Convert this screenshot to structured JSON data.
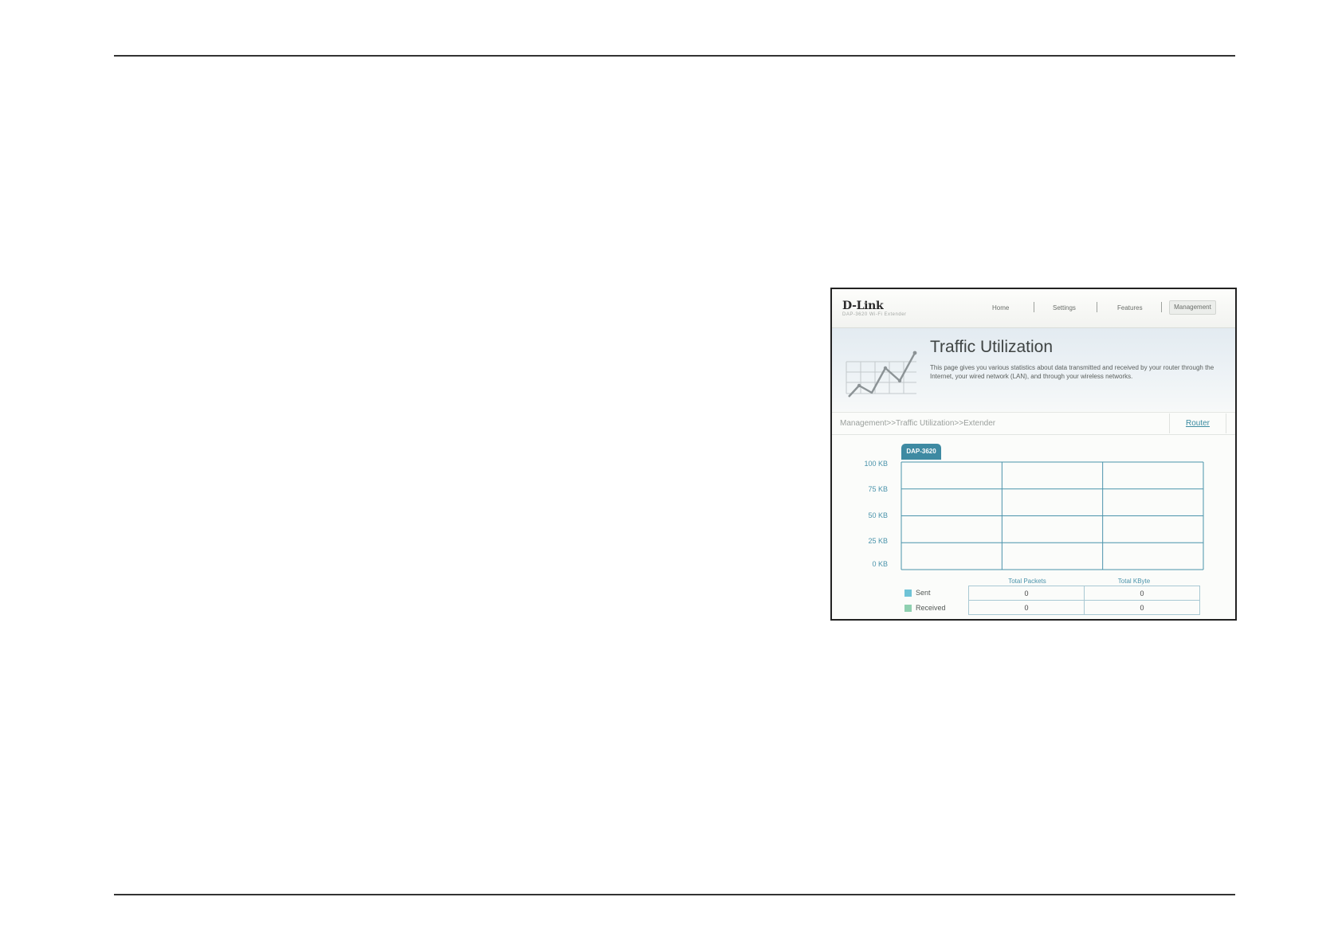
{
  "screenshot": {
    "header": {
      "logo": "D-Link",
      "logo_subtitle": "DAP-3620 Wi-Fi Extender",
      "nav": {
        "home": "Home",
        "settings": "Settings",
        "features": "Features",
        "management": "Management"
      },
      "active_nav": "Management"
    },
    "banner": {
      "title": "Traffic Utilization",
      "description": "This page gives you various statistics about data transmitted and received by your router through the Internet, your wired network (LAN), and through your wireless networks."
    },
    "breadcrumb": "Management>>Traffic Utilization>>Extender",
    "router_link": "Router",
    "chart": {
      "tab_label": "DAP-3620",
      "y_ticks": [
        "100 KB",
        "75 KB",
        "50 KB",
        "25 KB",
        "0 KB"
      ]
    },
    "stats": {
      "headers": [
        "Total Packets",
        "Total KByte"
      ],
      "rows": [
        {
          "label": "Sent",
          "color": "#6fc3d6",
          "total_packets": "0",
          "total_kbyte": "0"
        },
        {
          "label": "Received",
          "color": "#8fd0b0",
          "total_packets": "0",
          "total_kbyte": "0"
        }
      ]
    },
    "colors": {
      "accent": "#3e8aa2",
      "grid_line": "#4a93ab"
    }
  },
  "chart_data": {
    "type": "line",
    "categories": [],
    "series": [],
    "ylabel": "",
    "ylim": [
      0,
      100
    ],
    "yticks": [
      "0 KB",
      "25 KB",
      "50 KB",
      "75 KB",
      "100 KB"
    ],
    "grid": true
  }
}
